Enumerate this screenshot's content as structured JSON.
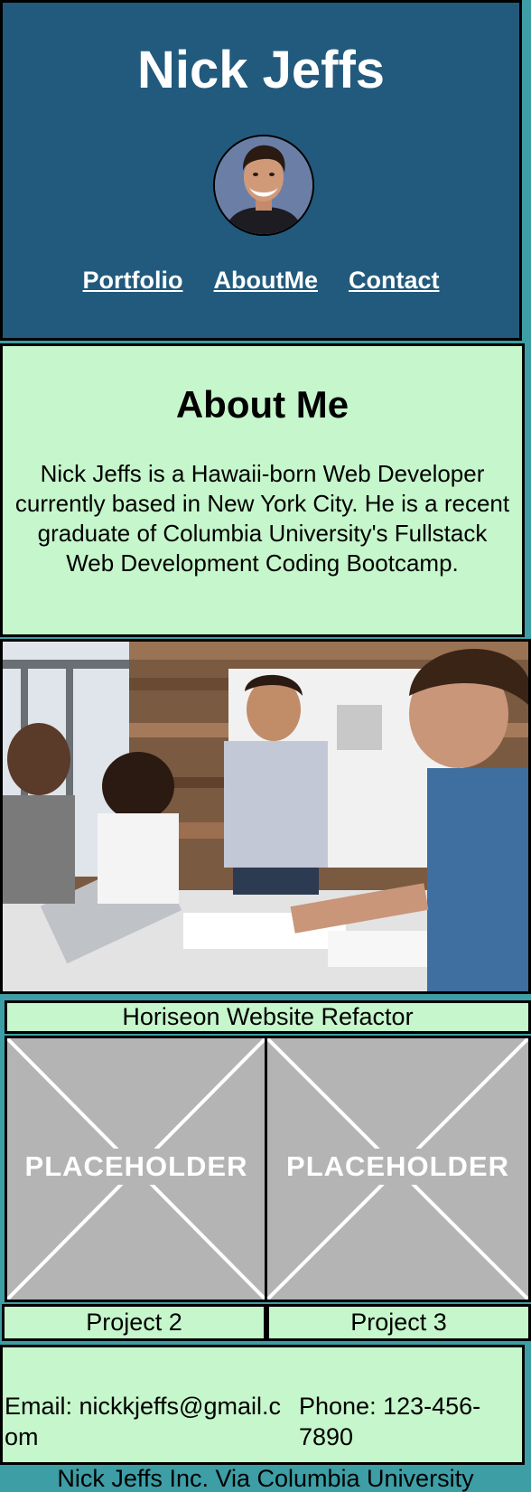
{
  "header": {
    "title": "Nick Jeffs",
    "nav": [
      "Portfolio",
      "AboutMe",
      "Contact"
    ]
  },
  "about": {
    "heading": "About Me",
    "body": "Nick Jeffs is a Hawaii-born Web Developer currently based in New York City. He is a recent graduate of Columbia University's Fullstack Web Development Coding Bootcamp."
  },
  "portfolio": {
    "featured_title": "Horiseon Website Refactor",
    "placeholder_label": "PLACEHOLDER",
    "projects": [
      "Project 2",
      "Project 3"
    ]
  },
  "contact": {
    "email": "Email: nickkjeffs@gmail.com",
    "phone": "Phone: 123-456-7890"
  },
  "footer": {
    "text": "Nick Jeffs Inc. Via Columbia University"
  },
  "colors": {
    "header_bg": "#215a7d",
    "panel_bg": "#c6f6cb",
    "page_bg": "#3d9ea5",
    "placeholder_bg": "#b4b4b4"
  }
}
